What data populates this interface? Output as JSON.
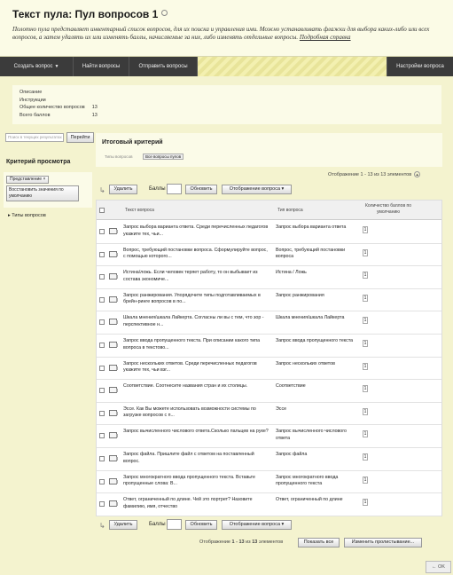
{
  "page": {
    "title": "Текст пула: Пул вопросов 1",
    "description": "Полотно пула представляет инвентарный список вопросов, для их поиска и управления ими. Можно устанавливать флажки для выбора каких-либо или всех вопросов, а затем удалять их или изменять баллы, начисляемые за них, либо изменять отдельные вопросы.",
    "description_link": "Подробная справка"
  },
  "menubar": {
    "create_question": "Создать вопрос",
    "find_questions": "Найти вопросы",
    "send_questions": "Отправить вопросы",
    "settings": "Настройки вопроса"
  },
  "summary": {
    "rows": [
      {
        "label": "Описание",
        "value": ""
      },
      {
        "label": "Инструкции",
        "value": ""
      },
      {
        "label": "Общее количество вопросов",
        "value": "13"
      },
      {
        "label": "Всего баллов",
        "value": "13"
      }
    ]
  },
  "sidebar": {
    "search_placeholder": "Поиск в текущих результатах",
    "go_button": "Перейти",
    "heading": "Критерий просмотра",
    "view_pill": "Представление",
    "restore_button": "Восстановить значения по умолчанию",
    "question_types": "Типы вопросов"
  },
  "criteria": {
    "heading": "Итоговый критерий",
    "label": "Типы вопросов",
    "pill": "Все вопросы пулов"
  },
  "display_top": "Отображение 1 - 13 из 13 элементов",
  "toolbar": {
    "delete": "Удалить",
    "points": "Баллы",
    "update": "Обновить",
    "view": "Отображение вопроса"
  },
  "table": {
    "col_text": "Текст вопроса",
    "col_type": "Тип вопроса",
    "col_points": "Количество баллов по умолчанию",
    "rows": [
      {
        "text": "Запрос выбора варианта ответа. Среди перечисленных педагогов укажите тех, чьи...",
        "type": "Запрос выбора варианта ответа",
        "points": "1"
      },
      {
        "text": "Вопрос, требующий постановки вопроса. Сформулируйте вопрос, с помощью которого...",
        "type": "Вопрос, требующий постановки вопроса",
        "points": "1"
      },
      {
        "text": "Истина/ложь. Если человек теряет работу, то он выбывает из состава экономиче...",
        "type": "Истина / Ложь",
        "points": "1"
      },
      {
        "text": "Запрос ранжирования. Упорядочите типы подготавливаемых в брейн-ринге вопросов в по...",
        "type": "Запрос ранжирования",
        "points": "1"
      },
      {
        "text": "Шкала мнения/шкала Лайкерта. Согласны ли вы с тем, что зор - перспективное н...",
        "type": "Шкала мнения/шкала Лайкерта",
        "points": "1"
      },
      {
        "text": "Запрос ввода пропущенного текста. При описании какого типа вопроса в текстово...",
        "type": "Запрос ввода пропущенного текста",
        "points": "1"
      },
      {
        "text": "Запрос нескольких ответов. Среди перечисленных педагогов укажите тех, чьи взг...",
        "type": "Запрос нескольких ответов",
        "points": "1"
      },
      {
        "text": "Соответствие. Соотнесите названия стран и их столицы.",
        "type": "Соответствие",
        "points": "1"
      },
      {
        "text": "Эссе. Как Вы можете использовать возможности системы по загрузке вопросов с п...",
        "type": "Эссе",
        "points": "1"
      },
      {
        "text": "Запрос вычисленного числового ответа.Сколько пальцев на руке?",
        "type": "Запрос вычисленного числового ответа",
        "points": "1"
      },
      {
        "text": "Запрос файла. Пришлите файл с ответом на поставленный вопрос.",
        "type": "Запрос файла",
        "points": "1"
      },
      {
        "text": "Запрос многократного ввода пропущенного текста. Вставьте пропущенные слова: В...",
        "type": "Запрос многократного ввода пропущенного текста",
        "points": "1"
      },
      {
        "text": "Ответ, ограниченный по длине. Чей это портрет? Назовите фамилию, имя, отчество",
        "type": "Ответ, ограниченный по длине",
        "points": "1"
      }
    ]
  },
  "footer": {
    "display_prefix": "Отображение ",
    "display_range": "1 - 13",
    "display_mid": " из ",
    "display_total": "13",
    "display_suffix": " элементов",
    "show_all": "Показать все",
    "change_paging": "Изменить пролистывание..."
  },
  "ok_button": "OK"
}
